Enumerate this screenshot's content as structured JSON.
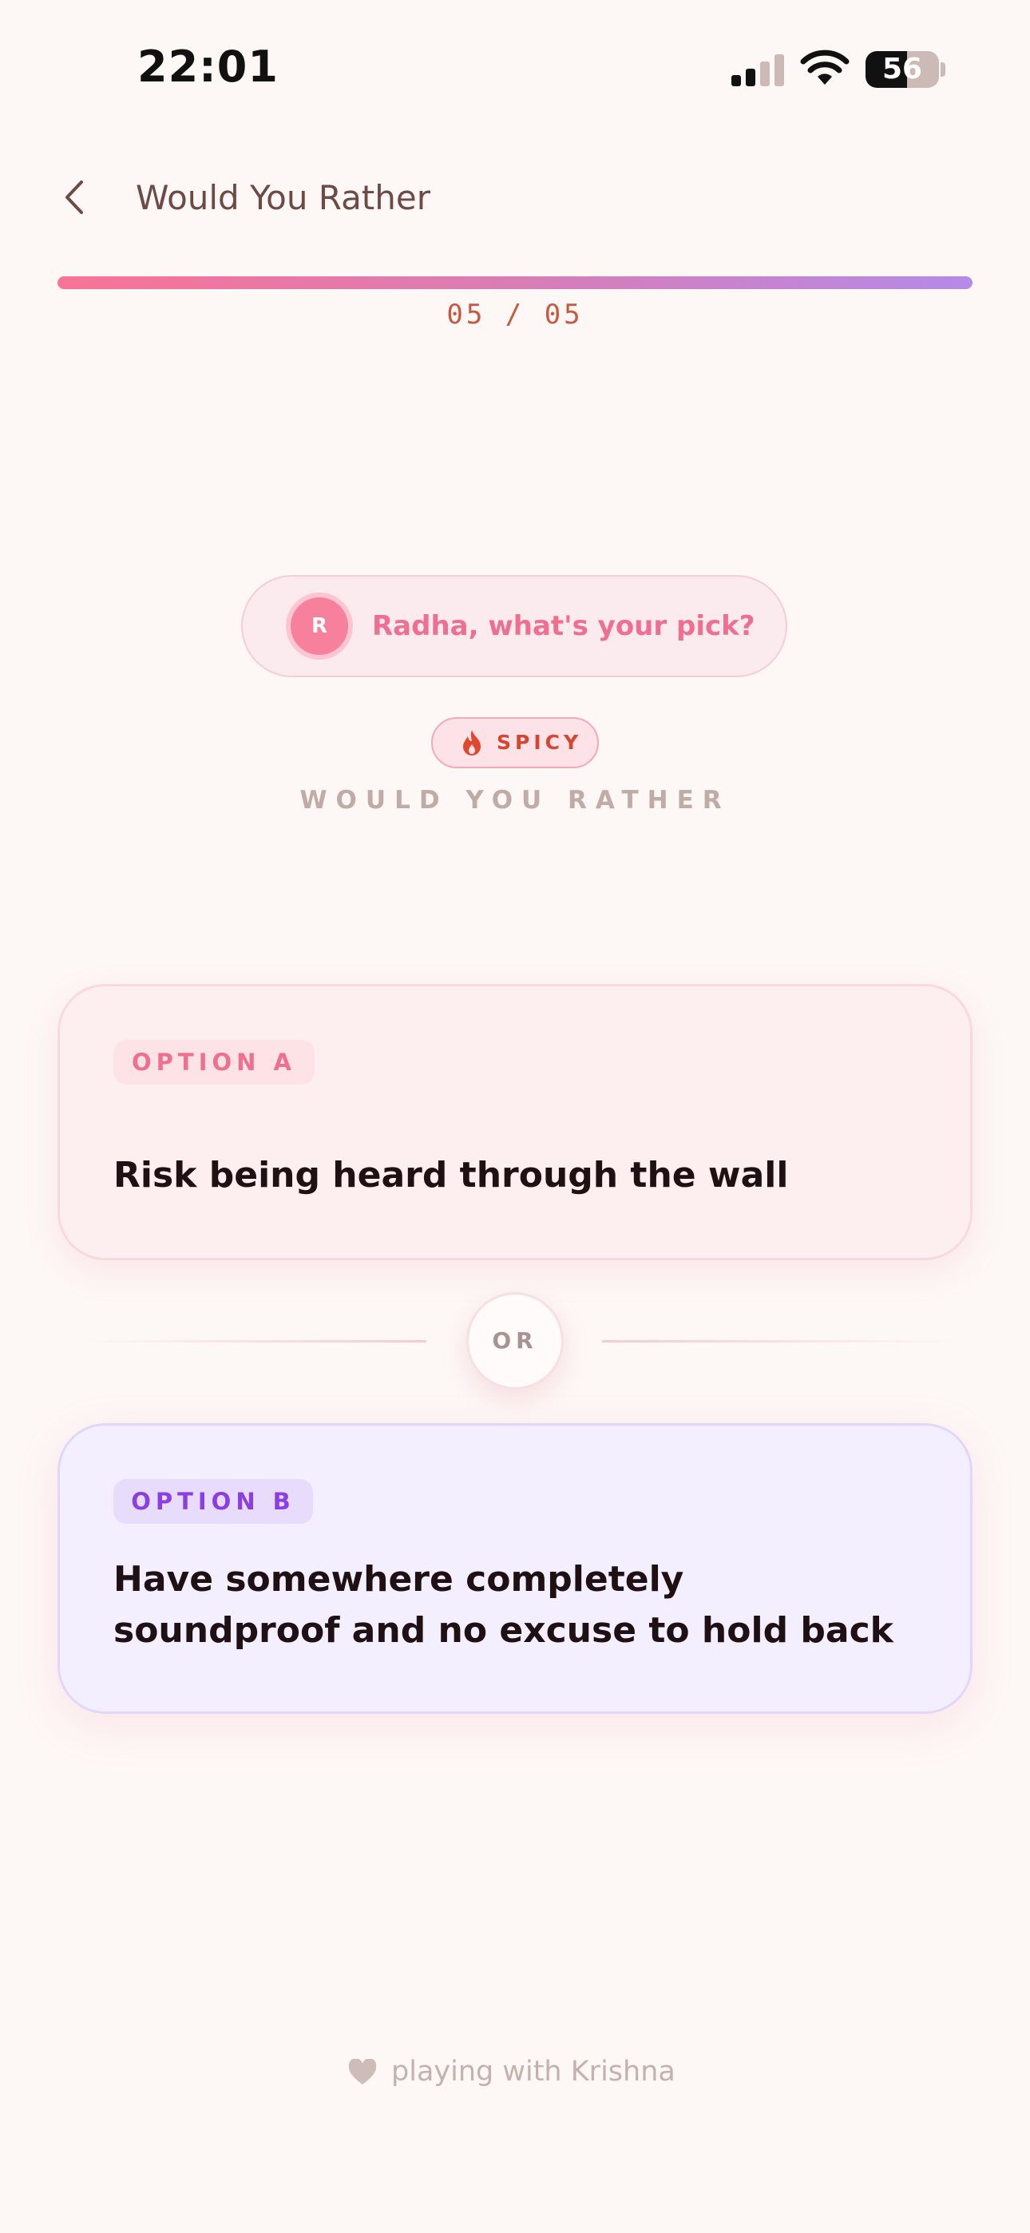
{
  "status_bar": {
    "time": "22:01",
    "battery": "56",
    "battery_level": 0.56
  },
  "header": {
    "title": "Would You Rather",
    "back_icon": "chevron-left-icon"
  },
  "progress": {
    "counter": "05 / 05",
    "fraction": 1.0
  },
  "turn": {
    "avatar_initial": "R",
    "prompt": "Radha, what's your pick?"
  },
  "category": {
    "badge": "SPICY",
    "badge_icon": "flame-icon",
    "subtitle": "WOULD YOU RATHER"
  },
  "option_a": {
    "tag": "OPTION A",
    "text": "Risk being heard through the wall"
  },
  "divider": {
    "label": "OR"
  },
  "option_b": {
    "tag": "OPTION B",
    "text": "Have somewhere completely soundproof and no excuse to hold back"
  },
  "footer": {
    "icon": "heart-icon",
    "text": "playing with Krishna"
  },
  "colors": {
    "background": "#fdf7f5",
    "accent_pink": "#ef6f92",
    "accent_purple": "#8b3fe3",
    "spicy_red": "#d6452f"
  }
}
